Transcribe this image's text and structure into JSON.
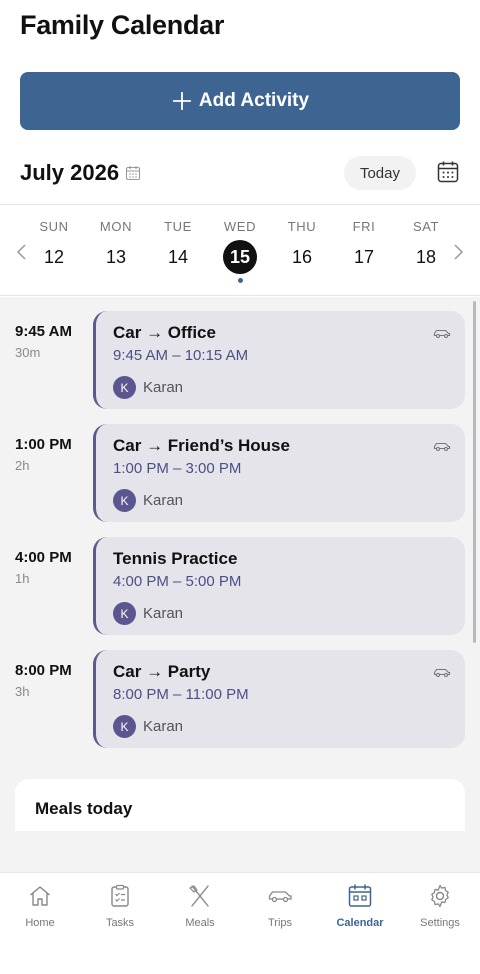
{
  "app": {
    "title": "Family Calendar"
  },
  "actions": {
    "add_label": "Add Activity",
    "add_icon": "plus-icon"
  },
  "calendar": {
    "month_label": "July 2026",
    "today_label": "Today"
  },
  "week": {
    "days": [
      {
        "name": "SUN",
        "num": "12"
      },
      {
        "name": "MON",
        "num": "13"
      },
      {
        "name": "TUE",
        "num": "14"
      },
      {
        "name": "WED",
        "num": "15"
      },
      {
        "name": "THU",
        "num": "16"
      },
      {
        "name": "FRI",
        "num": "17"
      },
      {
        "name": "SAT",
        "num": "18"
      }
    ],
    "selected_index": 3
  },
  "events": [
    {
      "time": "9:45 AM",
      "duration": "30m",
      "title": "Car → Office",
      "range": "9:45 AM – 10:15 AM",
      "person_initial": "K",
      "person": "Karan",
      "icon": "car-icon"
    },
    {
      "time": "1:00 PM",
      "duration": "2h",
      "title": "Car → Friend’s House",
      "range": "1:00 PM – 3:00 PM",
      "person_initial": "K",
      "person": "Karan",
      "icon": "car-icon"
    },
    {
      "time": "4:00 PM",
      "duration": "1h",
      "title": "Tennis Practice",
      "range": "4:00 PM – 5:00 PM",
      "person_initial": "K",
      "person": "Karan",
      "icon": ""
    },
    {
      "time": "8:00 PM",
      "duration": "3h",
      "title": "Car → Party",
      "range": "8:00 PM – 11:00 PM",
      "person_initial": "K",
      "person": "Karan",
      "icon": "car-icon"
    }
  ],
  "meals": {
    "title": "Meals today"
  },
  "nav": {
    "items": [
      {
        "label": "Home",
        "icon": "home-icon"
      },
      {
        "label": "Tasks",
        "icon": "clipboard-icon"
      },
      {
        "label": "Meals",
        "icon": "utensils-icon"
      },
      {
        "label": "Trips",
        "icon": "car-icon"
      },
      {
        "label": "Calendar",
        "icon": "calendar-icon"
      },
      {
        "label": "Settings",
        "icon": "gear-icon"
      }
    ],
    "active_index": 4
  },
  "colors": {
    "accent": "#3e6591",
    "card_bg": "#e4e4ea",
    "time_range": "#4b4f86",
    "avatar": "#5c5690"
  }
}
